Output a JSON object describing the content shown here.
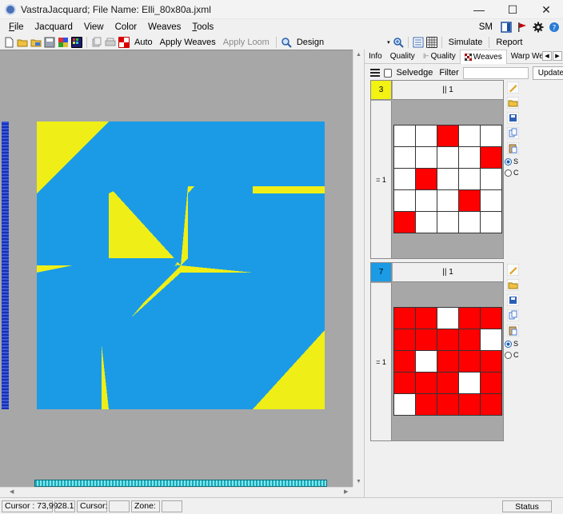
{
  "window": {
    "title": "VastraJacquard; File Name: Elli_80x80a.jxml",
    "minimize": "—",
    "maximize": "☐",
    "close": "✕"
  },
  "menu": {
    "items": [
      {
        "name": "menu-file",
        "first": "F",
        "rest": "ile",
        "underline": true
      },
      {
        "name": "menu-jacquard",
        "first": "",
        "rest": "Jacquard",
        "underline": false
      },
      {
        "name": "menu-view",
        "first": "",
        "rest": "View",
        "underline": false
      },
      {
        "name": "menu-color",
        "first": "",
        "rest": "Color",
        "underline": false
      },
      {
        "name": "menu-weaves",
        "first": "",
        "rest": "Weaves",
        "underline": false
      },
      {
        "name": "menu-tools",
        "first": "T",
        "rest": "ools",
        "underline": true
      }
    ],
    "sm_label": "SM"
  },
  "toolbar": {
    "auto": "Auto",
    "apply_weaves": "Apply Weaves",
    "apply_loom": "Apply Loom",
    "design": "Design",
    "simulate": "Simulate",
    "report": "Report"
  },
  "tabs": [
    "Info",
    "Quality",
    "Quality",
    "Weaves",
    "Warp Weft"
  ],
  "panel_toolbar": {
    "selvedge": "Selvedge",
    "filter": "Filter",
    "update": "Update"
  },
  "weave_blocks": [
    {
      "index": "3",
      "index_color": "#f2f213",
      "header": "|| 1",
      "side_label": "= 1",
      "cells": [
        "w",
        "w",
        "r",
        "w",
        "w",
        "w",
        "w",
        "w",
        "w",
        "r",
        "w",
        "r",
        "w",
        "w",
        "w",
        "w",
        "w",
        "w",
        "r",
        "w",
        "r",
        "w",
        "w",
        "w",
        "w"
      ]
    },
    {
      "index": "7",
      "index_color": "#1b9be6",
      "header": "|| 1",
      "side_label": "= 1",
      "cells": [
        "r",
        "r",
        "w",
        "r",
        "r",
        "r",
        "r",
        "r",
        "r",
        "w",
        "r",
        "w",
        "r",
        "r",
        "r",
        "r",
        "r",
        "r",
        "w",
        "r",
        "w",
        "r",
        "r",
        "r",
        "r"
      ]
    }
  ],
  "radio_labels": [
    "S",
    "C"
  ],
  "colors": {
    "yellow": "#efef17",
    "blue": "#1b9be6",
    "weave_red": "#ff0000",
    "canvas_bg": "#a7a7a7"
  },
  "status": {
    "cursor": "Cursor : 73,99",
    "zoom": "28.1",
    "cursor2": "Cursor:",
    "cursor2_value": "",
    "zone": "Zone:",
    "zone_value": "",
    "status": "Status"
  }
}
